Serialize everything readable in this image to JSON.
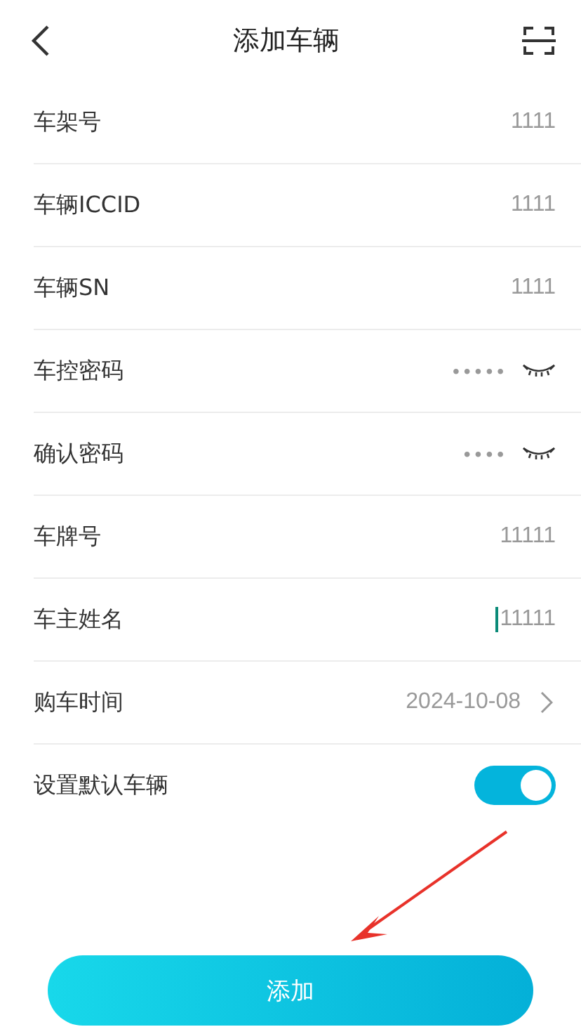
{
  "header": {
    "title": "添加车辆"
  },
  "fields": [
    {
      "kind": "text",
      "label": "车架号",
      "value": "1111",
      "focused": false
    },
    {
      "kind": "text",
      "label": "车辆ICCID",
      "value": "1111",
      "focused": false
    },
    {
      "kind": "text",
      "label": "车辆SN",
      "value": "1111",
      "focused": false
    },
    {
      "kind": "password",
      "label": "车控密码",
      "value": "•••••",
      "focused": false
    },
    {
      "kind": "password",
      "label": "确认密码",
      "value": "••••",
      "focused": false
    },
    {
      "kind": "text",
      "label": "车牌号",
      "value": "11111",
      "focused": false
    },
    {
      "kind": "text",
      "label": "车主姓名",
      "value": "11111",
      "focused": true
    },
    {
      "kind": "date",
      "label": "购车时间",
      "value": "2024-10-08"
    },
    {
      "kind": "toggle",
      "label": "设置默认车辆",
      "on": true
    }
  ],
  "submit": {
    "label": "添加"
  }
}
